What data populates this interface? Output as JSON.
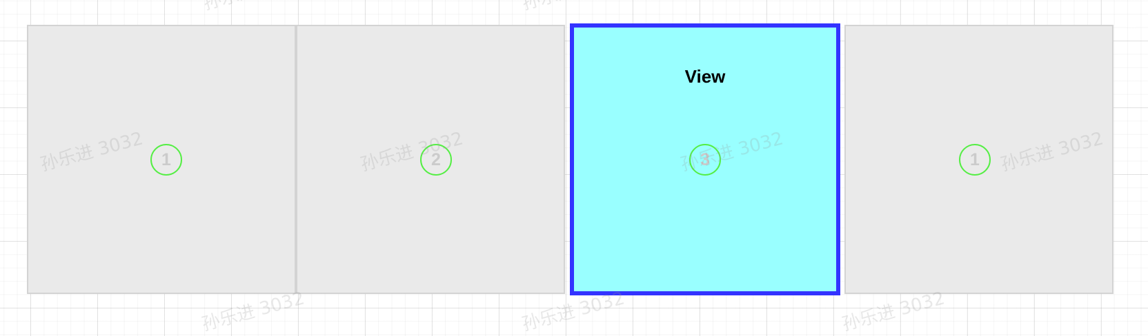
{
  "diagram": {
    "cells": [
      {
        "id": "c1",
        "badge": "1",
        "title": ""
      },
      {
        "id": "c2",
        "badge": "2",
        "title": ""
      },
      {
        "id": "view",
        "badge": "3",
        "title": "View"
      },
      {
        "id": "c4",
        "badge": "1",
        "title": ""
      }
    ],
    "watermark": "孙乐进 3032",
    "colors": {
      "cell_fill": "#eaeaea",
      "cell_border": "#d3d3d3",
      "view_fill": "#99ffff",
      "view_border": "#3333ff",
      "badge_ring": "#55ee44",
      "badge_text": "#cbcbcb"
    }
  }
}
